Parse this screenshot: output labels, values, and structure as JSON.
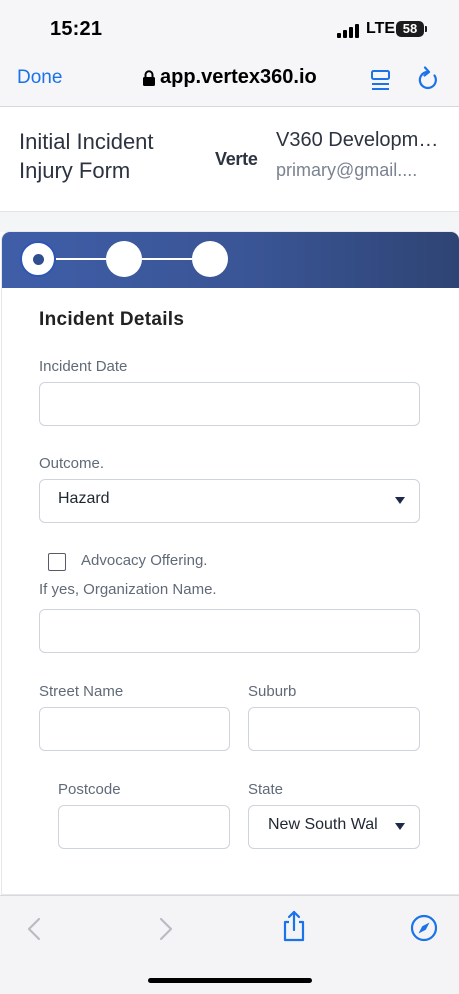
{
  "status_bar": {
    "time": "15:21",
    "network": "LTE",
    "battery": "58"
  },
  "browser": {
    "done_label": "Done",
    "url": "app.vertex360.io"
  },
  "header": {
    "form_title": "Initial Incident Injury Form",
    "brand": "Verte",
    "org_name": "V360 Developme...",
    "user_email": "primary@gmail...."
  },
  "stepper": {
    "steps": 3,
    "active_step": 1
  },
  "form": {
    "section_title": "Incident Details",
    "incident_date": {
      "label": "Incident Date",
      "value": ""
    },
    "outcome": {
      "label": "Outcome.",
      "value": "Hazard"
    },
    "advocacy": {
      "label": "Advocacy Offering.",
      "checked": false
    },
    "org_name_field": {
      "label": "If yes, Organization Name.",
      "value": ""
    },
    "street_name": {
      "label": "Street Name",
      "value": ""
    },
    "suburb": {
      "label": "Suburb",
      "value": ""
    },
    "postcode": {
      "label": "Postcode",
      "value": ""
    },
    "state": {
      "label": "State",
      "value": "New South Wal"
    }
  },
  "colors": {
    "accent": "#1a73e8",
    "stepper_start": "#3f5ea8",
    "stepper_end": "#2e4474"
  },
  "icons": [
    "lock-icon",
    "reader-icon",
    "reload-icon",
    "back-icon",
    "forward-icon",
    "share-icon",
    "compass-icon"
  ]
}
